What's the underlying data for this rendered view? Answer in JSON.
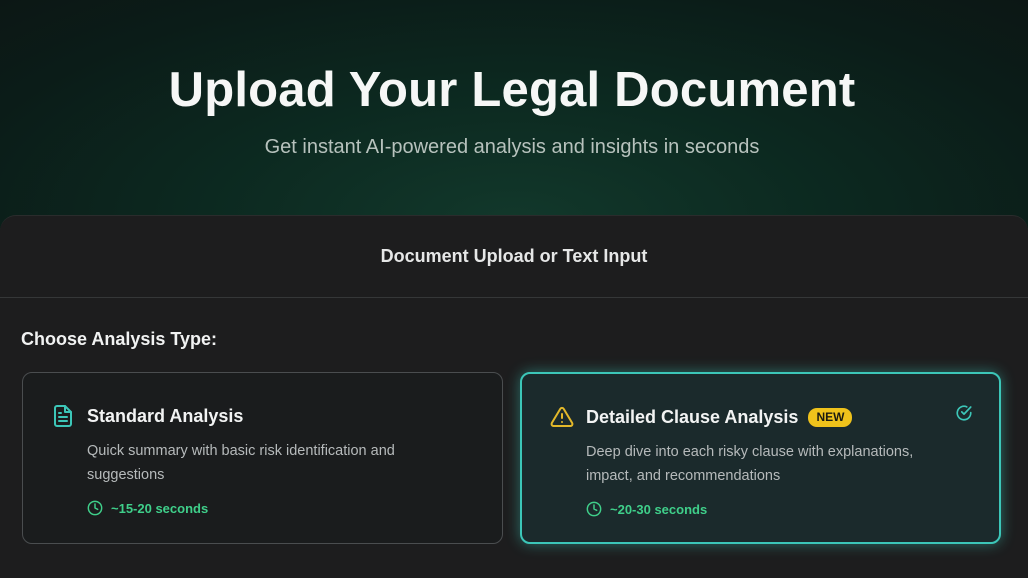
{
  "hero": {
    "title": "Upload Your Legal Document",
    "subtitle": "Get instant AI-powered analysis and insights in seconds"
  },
  "panel": {
    "header": "Document Upload or Text Input",
    "section_label": "Choose Analysis Type:"
  },
  "analysis_types": [
    {
      "title": "Standard Analysis",
      "description": "Quick summary with basic risk identification and suggestions",
      "time": "~15-20 seconds",
      "icon": "document-icon",
      "selected": false
    },
    {
      "title": "Detailed Clause Analysis",
      "badge": "NEW",
      "description": "Deep dive into each risky clause with explanations, impact, and recommendations",
      "time": "~20-30 seconds",
      "icon": "warning-icon",
      "selected": true
    }
  ],
  "colors": {
    "accent": "#3cc6b8",
    "time_green": "#3fcf8a",
    "badge_yellow": "#efc21b",
    "warning_yellow": "#e3b82a"
  }
}
